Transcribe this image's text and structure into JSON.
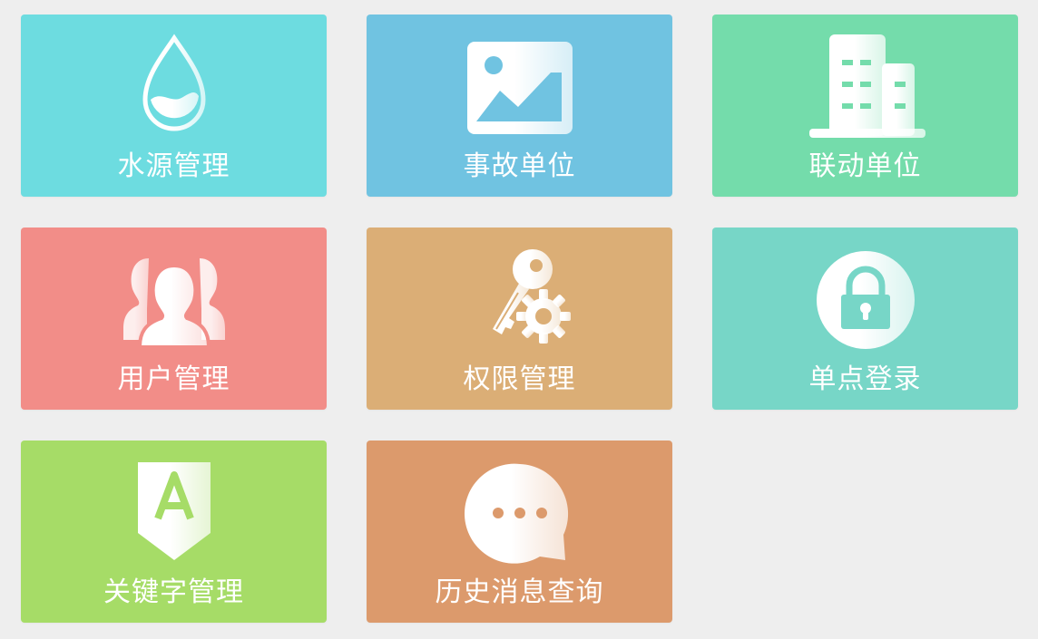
{
  "tiles": [
    {
      "label": "水源管理",
      "icon": "water-drop-icon",
      "color": "#6ddce0"
    },
    {
      "label": "事故单位",
      "icon": "image-icon",
      "color": "#70c3e1"
    },
    {
      "label": "联动单位",
      "icon": "building-icon",
      "color": "#74dcab"
    },
    {
      "label": "用户管理",
      "icon": "users-icon",
      "color": "#f28d88"
    },
    {
      "label": "权限管理",
      "icon": "key-gear-icon",
      "color": "#dbae76"
    },
    {
      "label": "单点登录",
      "icon": "lock-icon",
      "color": "#77d6c7"
    },
    {
      "label": "关键字管理",
      "icon": "keyword-tag-icon",
      "color": "#a6dc67"
    },
    {
      "label": "历史消息查询",
      "icon": "chat-bubble-icon",
      "color": "#dc9a6c"
    }
  ]
}
